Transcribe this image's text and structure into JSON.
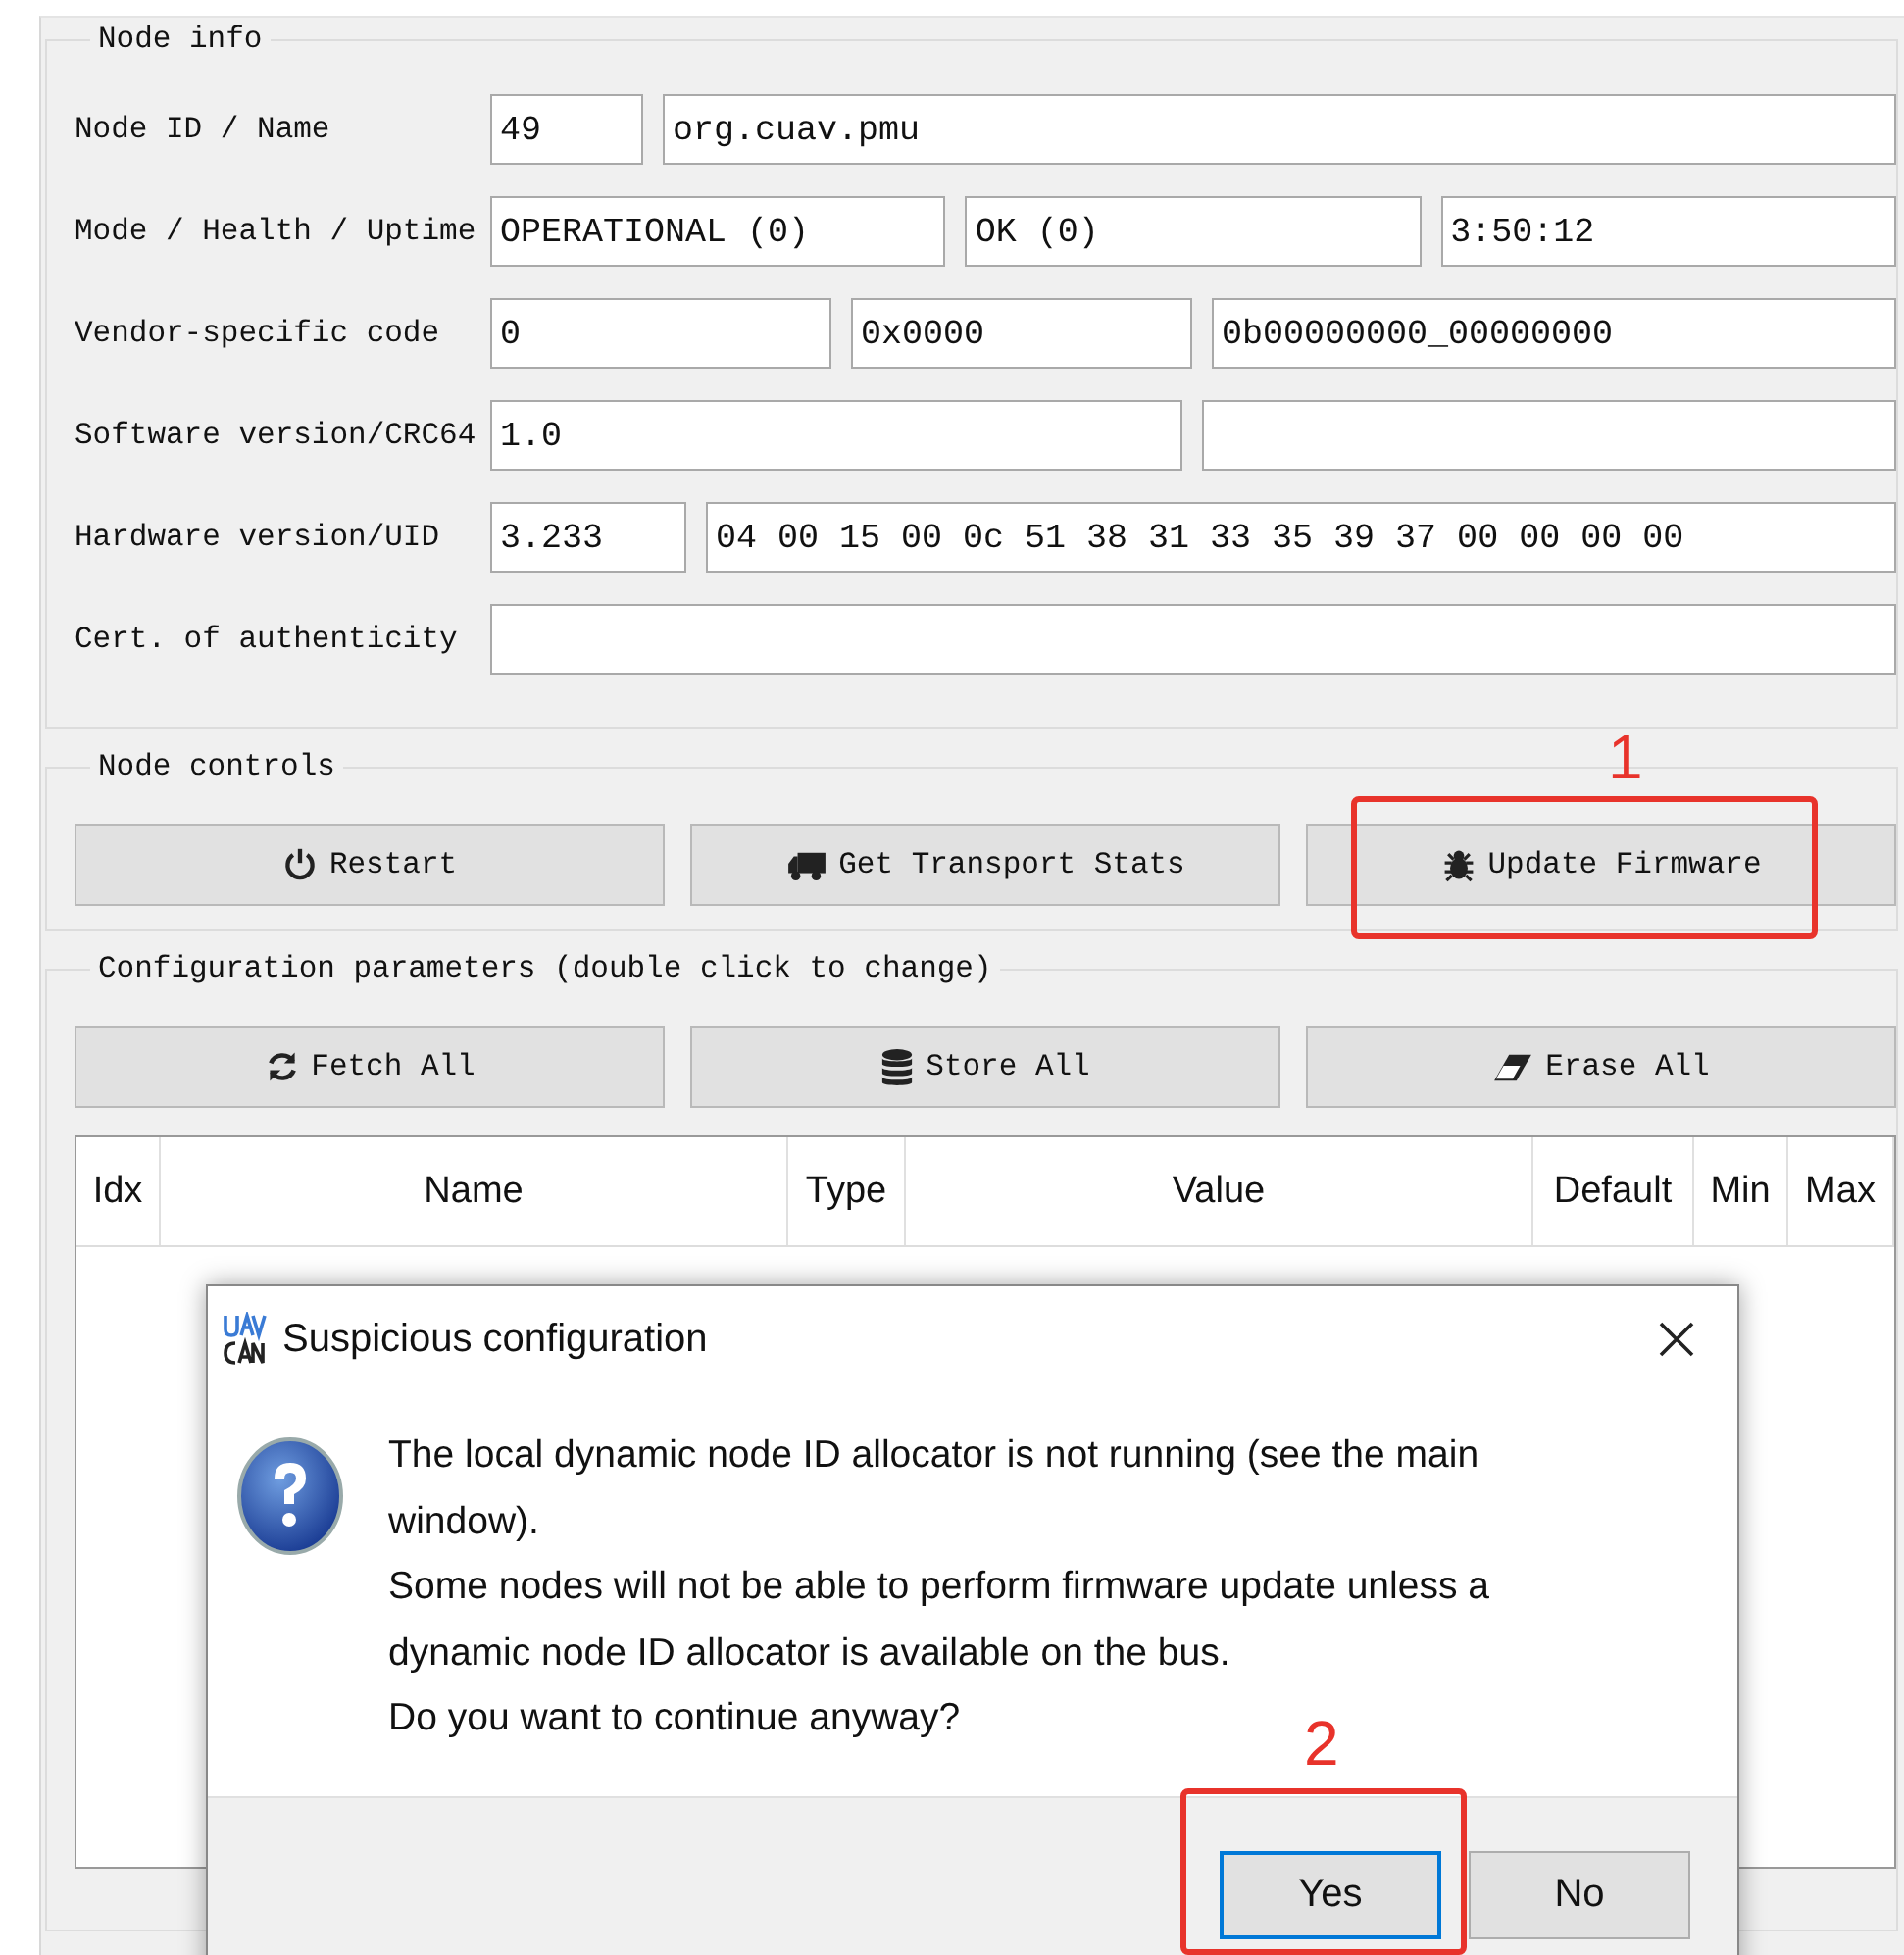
{
  "node_info": {
    "title": "Node info",
    "rows": [
      {
        "label": "Node ID / Name",
        "fields": [
          {
            "value": "49"
          },
          {
            "value": "org.cuav.pmu"
          }
        ]
      },
      {
        "label": "Mode / Health / Uptime",
        "fields": [
          {
            "value": "OPERATIONAL (0)"
          },
          {
            "value": "OK (0)"
          },
          {
            "value": "3:50:12"
          }
        ]
      },
      {
        "label": "Vendor-specific code",
        "fields": [
          {
            "value": "0"
          },
          {
            "value": "0x0000"
          },
          {
            "value": "0b00000000_00000000"
          }
        ]
      },
      {
        "label": "Software version/CRC64",
        "fields": [
          {
            "kind": "text",
            "value": "1.0"
          },
          {
            "kind": "blank"
          }
        ]
      },
      {
        "label": "Hardware version/UID",
        "fields": [
          {
            "value": "3.233"
          },
          {
            "value": "04 00 15 00 0c 51 38 31 33 35 39 37 00 00 00 00"
          }
        ]
      },
      {
        "label": "Cert. of authenticity",
        "fields": [
          {
            "kind": "blank"
          }
        ]
      }
    ]
  },
  "node_controls": {
    "title": "Node controls",
    "buttons": [
      "Restart",
      "Get Transport Stats",
      "Update Firmware"
    ]
  },
  "config": {
    "title": "Configuration parameters (double click to change)",
    "buttons": [
      "Fetch All",
      "Store All",
      "Erase All"
    ],
    "table": {
      "columns": [
        "Idx",
        "Name",
        "Type",
        "Value",
        "Default",
        "Min",
        "Max"
      ]
    }
  },
  "dialog": {
    "title": "Suspicious configuration",
    "paragraphs": [
      {
        "lines": [
          "The local dynamic node ID allocator is not running (see the main",
          "window)."
        ]
      },
      {
        "lines": [
          "Some nodes will not be able to perform firmware update unless a",
          "dynamic node ID allocator is available on the bus."
        ]
      },
      {
        "lines": [
          "Do you want to continue anyway?"
        ]
      }
    ],
    "buttons": [
      {
        "label": "Yes",
        "selected": true
      },
      {
        "label": "No",
        "selected": false
      }
    ]
  },
  "annotations": [
    {
      "label": "1"
    },
    {
      "label": "2"
    }
  ]
}
